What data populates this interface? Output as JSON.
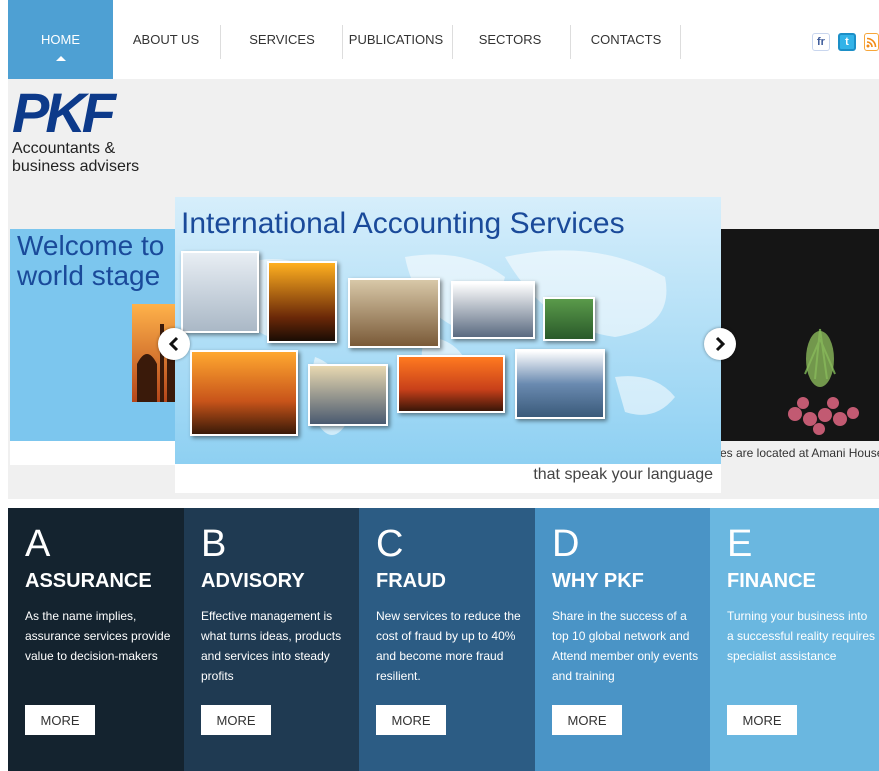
{
  "nav": {
    "items": [
      {
        "label": "HOME",
        "active": true
      },
      {
        "label": "ABOUT US"
      },
      {
        "label": "SERVICES"
      },
      {
        "label": "PUBLICATIONS"
      },
      {
        "label": "SECTORS"
      },
      {
        "label": "CONTACTS"
      }
    ],
    "social": [
      {
        "icon": "facebook-icon",
        "glyph": "fr"
      },
      {
        "icon": "twitter-icon",
        "glyph": "t"
      },
      {
        "icon": "rss-icon",
        "glyph": "Σ"
      }
    ]
  },
  "logo": {
    "mark": "PKF",
    "line1": "Accountants &",
    "line2": "business advisers"
  },
  "slider": {
    "left_title_line1": "Welcome to",
    "left_title_line2": "world stage",
    "main_title": "International Accounting Services",
    "main_caption": "that speak your language",
    "right_caption": "es are located at Amani House"
  },
  "services": [
    {
      "letter": "A",
      "title": "ASSURANCE",
      "text": "As the name implies, assurance services provide value to decision-makers",
      "button": "MORE",
      "color": "#14232f"
    },
    {
      "letter": "B",
      "title": "ADVISORY",
      "text": "Effective management is what turns ideas, products and services into steady profits",
      "button": "MORE",
      "color": "#1f3a52"
    },
    {
      "letter": "C",
      "title": "FRAUD",
      "text": "New services to reduce the cost of fraud by up to 40% and become more fraud resilient.",
      "button": "MORE",
      "color": "#2c5c84"
    },
    {
      "letter": "D",
      "title": "WHY PKF",
      "text": "Share in the success of a top 10 global network and Attend member only events and training",
      "button": "MORE",
      "color": "#4a94c6"
    },
    {
      "letter": "E",
      "title": "FINANCE",
      "text": "Turning your business into a successful reality requires specialist assistance",
      "button": "MORE",
      "color": "#6ab7e0"
    }
  ],
  "colors": {
    "nav_active": "#4ea0d3",
    "brand_blue": "#0d3a8a"
  }
}
